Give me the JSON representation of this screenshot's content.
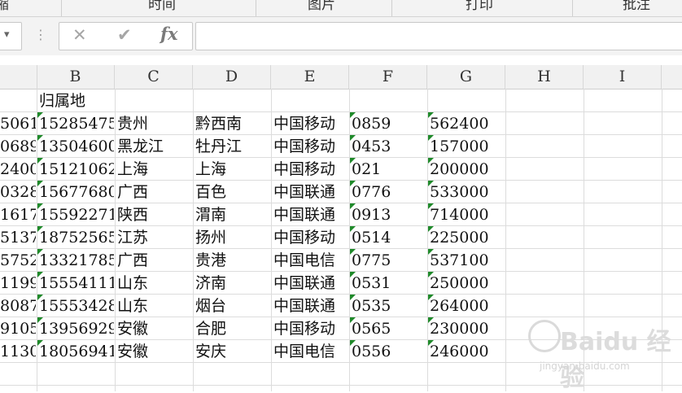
{
  "ribbon": {
    "groups": [
      "缩",
      "时间",
      "图片",
      "打印",
      "批注"
    ]
  },
  "formula_bar": {
    "cancel_icon": "✕",
    "confirm_icon": "✔",
    "fx_label": "fx",
    "value": ""
  },
  "columns": [
    "B",
    "C",
    "D",
    "E",
    "F",
    "G",
    "H",
    "I"
  ],
  "sheet": {
    "header_row": {
      "B": "归属地"
    },
    "rows": [
      {
        "A": "5061",
        "B": "15285475(",
        "C": "贵州",
        "D": "黔西南",
        "E": "中国移动",
        "F": "0859",
        "G": "562400"
      },
      {
        "A": "0689",
        "B": "13504600(",
        "C": "黑龙江",
        "D": "牡丹江",
        "E": "中国移动",
        "F": "0453",
        "G": "157000"
      },
      {
        "A": "2400",
        "B": "15121062↓",
        "C": "上海",
        "D": "上海",
        "E": "中国移动",
        "F": "021",
        "G": "200000"
      },
      {
        "A": "0328",
        "B": "15677680:",
        "C": "广西",
        "D": "百色",
        "E": "中国联通",
        "F": "0776",
        "G": "533000"
      },
      {
        "A": "1617",
        "B": "15592271(",
        "C": "陕西",
        "D": "渭南",
        "E": "中国联通",
        "F": "0913",
        "G": "714000"
      },
      {
        "A": "5137",
        "B": "18752565:",
        "C": "江苏",
        "D": "扬州",
        "E": "中国移动",
        "F": "0514",
        "G": "225000"
      },
      {
        "A": "5752",
        "B": "13321785′",
        "C": "广西",
        "D": "贵港",
        "E": "中国电信",
        "F": "0775",
        "G": "537100"
      },
      {
        "A": "1199",
        "B": "15554111:",
        "C": "山东",
        "D": "济南",
        "E": "中国联通",
        "F": "0531",
        "G": "250000"
      },
      {
        "A": "8087",
        "B": "15553428(",
        "C": "山东",
        "D": "烟台",
        "E": "中国联通",
        "F": "0535",
        "G": "264000"
      },
      {
        "A": "9105",
        "B": "13956929:",
        "C": "安徽",
        "D": "合肥",
        "E": "中国移动",
        "F": "0565",
        "G": "230000"
      },
      {
        "A": "1130",
        "B": "18056941:",
        "C": "安徽",
        "D": "安庆",
        "E": "中国电信",
        "F": "0556",
        "G": "246000"
      }
    ]
  },
  "watermark": {
    "main": "Baidu 经验",
    "sub": "jingyan.baidu.com"
  },
  "colors": {
    "text_indicator": "#1f8a2a",
    "header_bg": "#f1f1f1"
  }
}
